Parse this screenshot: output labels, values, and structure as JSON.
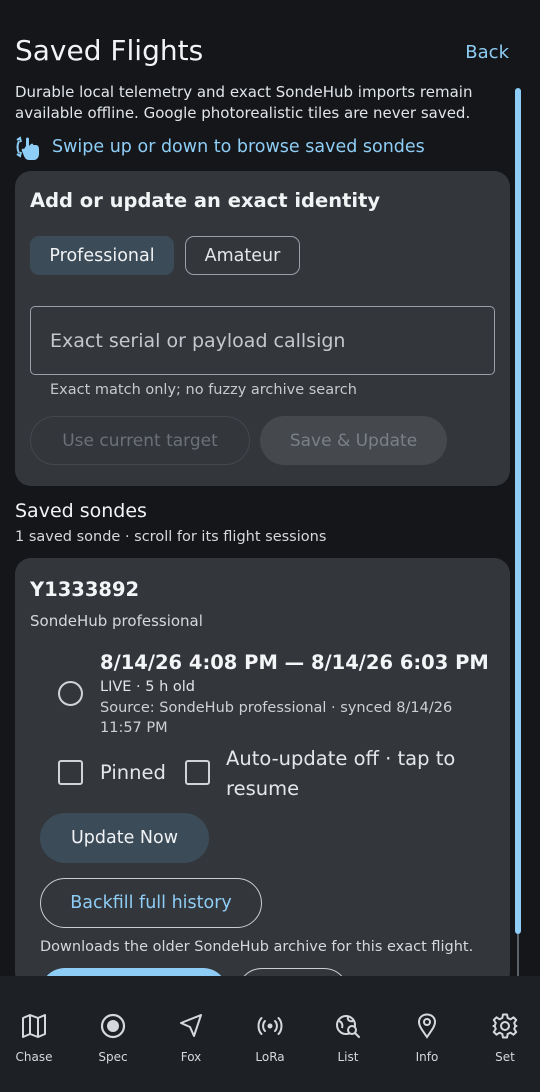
{
  "header": {
    "title": "Saved Flights",
    "back_label": "Back"
  },
  "intro_text": "Durable local telemetry and exact SondeHub imports remain available offline. Google photorealistic tiles are never saved.",
  "swipe_hint": "Swipe up or down to browse saved sondes",
  "identity_card": {
    "title": "Add or update an exact identity",
    "type_professional": "Professional",
    "type_amateur": "Amateur",
    "selected_type": "Professional",
    "serial_placeholder": "Exact serial or payload callsign",
    "serial_value": "",
    "helper": "Exact match only; no fuzzy archive search",
    "use_current_label": "Use current target",
    "save_update_label": "Save & Update"
  },
  "saved_section": {
    "title": "Saved sondes",
    "subtitle": "1 saved sonde · scroll for its flight sessions"
  },
  "sonde": {
    "serial": "Y1333892",
    "source": "SondeHub professional",
    "session": {
      "time_range": "8/14/26 4:08 PM — 8/14/26 6:03 PM",
      "live_status": "LIVE · 5 h old",
      "source_detail": "Source: SondeHub professional · synced 8/14/26 11:57 PM",
      "selected": false
    },
    "pinned_label": "Pinned",
    "pinned": false,
    "auto_update_label": "Auto-update off · tap to resume",
    "auto_update": false,
    "update_now_label": "Update Now",
    "backfill_label": "Backfill full history",
    "backfill_note": "Downloads the older SondeHub archive for this exact flight."
  },
  "nav": [
    {
      "label": "Chase",
      "icon": "map-icon"
    },
    {
      "label": "Spec",
      "icon": "radio-button-icon"
    },
    {
      "label": "Fox",
      "icon": "navigation-arrow-icon"
    },
    {
      "label": "LoRa",
      "icon": "broadcast-icon"
    },
    {
      "label": "List",
      "icon": "travel-explore-icon"
    },
    {
      "label": "Info",
      "icon": "location-pin-icon"
    },
    {
      "label": "Set",
      "icon": "gear-icon"
    }
  ],
  "colors": {
    "background": "#141619",
    "card": "#33363b",
    "accent": "#8ecdf5",
    "selected_chip": "#3b4b58",
    "nav_bar": "#1d2024"
  }
}
